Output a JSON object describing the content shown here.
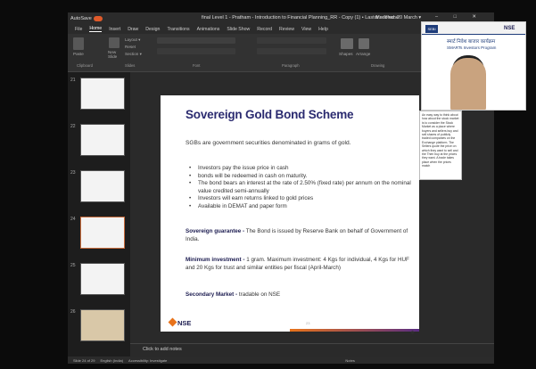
{
  "titlebar": {
    "autosave": "AutoSave",
    "doc_title": "final Level 1 - Pratham - Introduction to Financial Planning_RR - Copy (1) • Last Modified: 20 March ▾",
    "user": "dr.s lohane",
    "window_buttons": "– □ ✕"
  },
  "tabs": [
    "File",
    "Home",
    "Insert",
    "Draw",
    "Design",
    "Transitions",
    "Animations",
    "Slide Show",
    "Record",
    "Review",
    "View",
    "Help"
  ],
  "ribbon": {
    "paste": "Paste",
    "new_slide": "New Slide",
    "layout": "Layout ▾",
    "reset": "Reset",
    "section": "Section ▾",
    "groups": [
      "Clipboard",
      "Slides",
      "Font",
      "Paragraph",
      "Drawing"
    ],
    "shapes": "Shapes",
    "arrange": "Arrange"
  },
  "sidebar": {
    "slide_numbers": [
      "21",
      "22",
      "23",
      "24",
      "25",
      "26"
    ]
  },
  "slide": {
    "title": "Sovereign Gold Bond Scheme",
    "intro": "SGBs are government securities denominated in grams of gold.",
    "bullets": [
      "Investors pay the issue price in cash",
      "bonds will be redeemed in cash on maturity.",
      "The bond bears an interest at the rate of 2.50% (fixed rate) per annum on the nominal value credited semi-annually",
      "Investors will earn returns linked to gold prices",
      "Available in DEMAT and paper form"
    ],
    "guarantee_label": "Sovereign guarantee -",
    "guarantee_text": " The Bond is issued by Reserve Bank on behalf of Government of India.",
    "min_label": "Minimum investment -",
    "min_text": " 1 gram. Maximum investment: 4 Kgs for individual, 4 Kgs for HUF and 20 Kgs for trust and similar entities per fiscal (April-March)",
    "sec_label": "Secondary Market -",
    "sec_text": " tradable on NSE",
    "footer_logo": "NSE",
    "page_no": "23"
  },
  "notes_placeholder": "Click to add notes",
  "status": {
    "slide_info": "Slide 24 of 29",
    "language": "English (India)",
    "accessibility": "Accessibility: Investigate",
    "notes": "Notes"
  },
  "webcam": {
    "hindi_title": "स्मार्ट निवेश बाजार कार्यक्रम",
    "english_title": "SMARTs Investors Program",
    "logo": "NSE"
  },
  "chat_text": "An easy way to think about how about the stock market is to consider the Stock Market as a place where buyers and sellers buy and sell shares of publicly traded companies on the Exchange platform. The Sellers quote the price on which they want to sell and the Then buy at the prices they want. A trade takes place when the prices match"
}
